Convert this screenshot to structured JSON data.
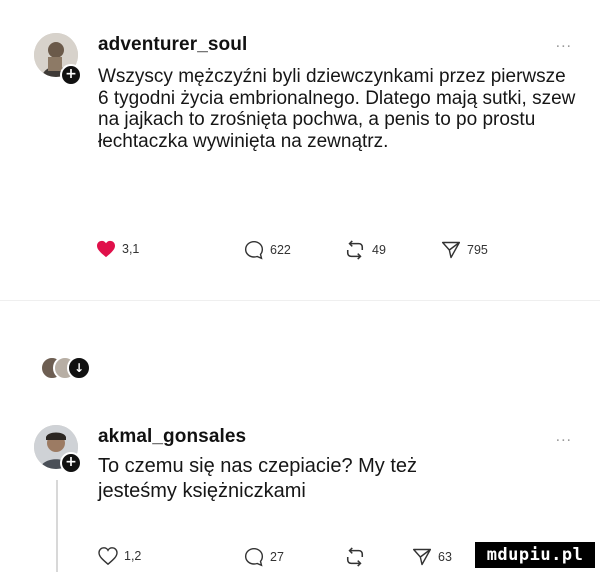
{
  "post1": {
    "username": "adventurer_soul",
    "more": "...",
    "text": "Wszyscy mężczyźni byli dziewczynkami przez pierwsze 6 tygodni życia embrionalnego. Dlatego mają sutki, szew na jajkach to zrośnięta pochwa, a penis to po prostu łechtaczka wywinięta na zewnątrz.",
    "likes": "3,1",
    "comments": "622",
    "reposts": "49",
    "shares": "795",
    "like_color": "#e0104a"
  },
  "post2": {
    "username": "akmal_gonsales",
    "more": "...",
    "text": "To czemu się nas czepiacie? My też jesteśmy księżniczkami",
    "likes": "1,2",
    "comments": "27",
    "reposts": "",
    "shares": "63"
  },
  "reaction_icons": [
    "avatar-icon",
    "avatar-icon",
    "download-icon"
  ],
  "watermark": "mdupiu.pl"
}
